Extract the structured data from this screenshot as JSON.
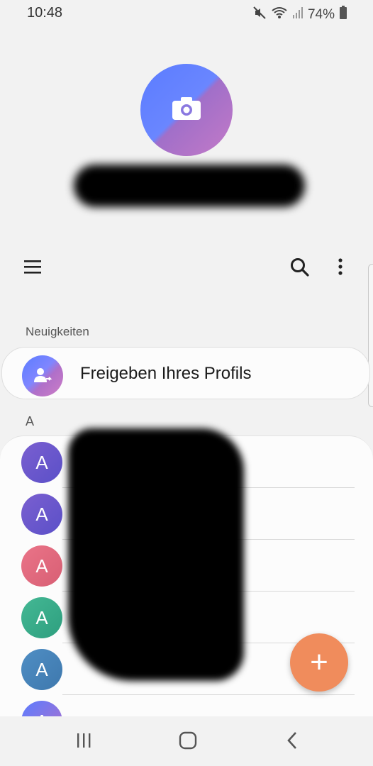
{
  "status_bar": {
    "time": "10:48",
    "battery": "74%",
    "icons": [
      "mute-icon",
      "wifi-icon",
      "signal-icon",
      "battery-icon"
    ]
  },
  "profile": {
    "avatar_icon": "camera-icon",
    "name": ""
  },
  "toolbar": {
    "icons": [
      "menu-icon",
      "search-icon",
      "more-vert-icon"
    ]
  },
  "news": {
    "header": "Neuigkeiten",
    "share_profile_label": "Freigeben Ihres Profils",
    "share_icon": "person-share-icon"
  },
  "contacts": {
    "index_letter": "A",
    "items": [
      {
        "initial": "A",
        "name": "",
        "color": "#6a5acd"
      },
      {
        "initial": "A",
        "name": "",
        "color": "#6a5acd"
      },
      {
        "initial": "A",
        "name": "",
        "color": "#e06b7d"
      },
      {
        "initial": "A",
        "name": "",
        "color": "#3fae8c"
      },
      {
        "initial": "A",
        "name": "",
        "color": "#4a86b8"
      },
      {
        "initial": "A",
        "name": "",
        "color": "#7c6cf0"
      }
    ]
  },
  "fab": {
    "icon": "plus-icon",
    "label": "+"
  },
  "nav_bar": {
    "icons": [
      "recents-icon",
      "home-icon",
      "back-icon"
    ]
  },
  "colors": {
    "background": "#f2f2f2",
    "fab": "#f08c5c",
    "accent": "#5b7cff"
  }
}
